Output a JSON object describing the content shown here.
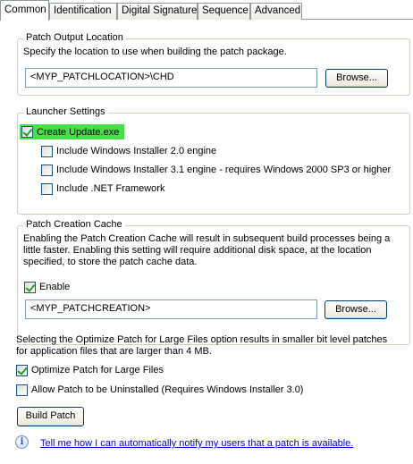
{
  "tabs": [
    {
      "label": "Common",
      "active": true
    },
    {
      "label": "Identification"
    },
    {
      "label": "Digital Signature"
    },
    {
      "label": "Sequence"
    },
    {
      "label": "Advanced"
    }
  ],
  "patch_output": {
    "legend": "Patch Output Location",
    "description": "Specify the location to use when building the patch package.",
    "path_value": "<MYP_PATCHLOCATION>\\CHD",
    "browse_label": "Browse..."
  },
  "launcher": {
    "legend": "Launcher Settings",
    "create_update": {
      "label": "Create Update.exe",
      "checked": true
    },
    "options": [
      {
        "label": "Include Windows Installer 2.0 engine",
        "checked": false
      },
      {
        "label": "Include Windows Installer 3.1 engine - requires Windows 2000 SP3 or higher",
        "checked": false
      },
      {
        "label": "Include .NET Framework",
        "checked": false
      }
    ]
  },
  "cache": {
    "legend": "Patch Creation Cache",
    "description": "Enabling the Patch Creation Cache will result in subsequent build processes being a little faster. Enabling this setting will require additional disk space, at the location specified, to store the patch cache data.",
    "enable": {
      "label": "Enable",
      "checked": true
    },
    "path_value": "<MYP_PATCHCREATION>",
    "browse_label": "Browse..."
  },
  "optimize_note": "Selecting the Optimize Patch for Large Files option results in smaller bit level patches for application files that are larger than 4 MB.",
  "optimize": {
    "label": "Optimize Patch for Large Files",
    "checked": true
  },
  "uninstall": {
    "label": "Allow Patch to be Uninstalled (Requires Windows Installer 3.0)",
    "checked": false
  },
  "build_label": "Build Patch",
  "help_link": "Tell me how I can automatically notify my users that a patch is available.",
  "icons": {
    "info": "info-icon",
    "check": "checkmark"
  }
}
